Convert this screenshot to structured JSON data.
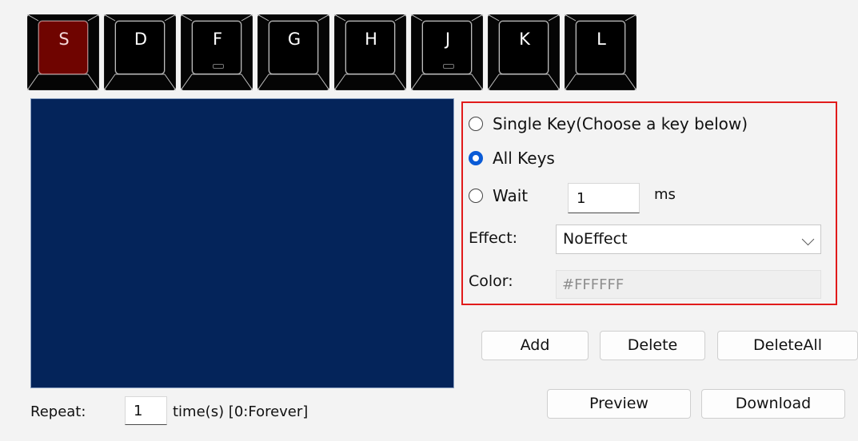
{
  "keys": [
    "S",
    "D",
    "F",
    "G",
    "H",
    "J",
    "K",
    "L"
  ],
  "active_key": "S",
  "home_keys": [
    "F",
    "J"
  ],
  "settings": {
    "single_key_label": "Single Key(Choose a key below)",
    "all_keys_label": "All Keys",
    "wait_label": "Wait",
    "wait_value": "1",
    "wait_unit": "ms",
    "selected_mode": "All Keys",
    "effect_label": "Effect:",
    "effect_value": "NoEffect",
    "color_label": "Color:",
    "color_value": "#FFFFFF"
  },
  "buttons": {
    "add": "Add",
    "delete": "Delete",
    "delete_all": "DeleteAll",
    "preview": "Preview",
    "download": "Download"
  },
  "repeat": {
    "label": "Repeat:",
    "value": "1",
    "hint": "time(s) [0:Forever]"
  },
  "colors": {
    "preview_bg": "#04245a",
    "active_key": "#6f0400",
    "highlight_border": "#e11b1b",
    "radio_accent": "#0a5bd6"
  },
  "icons": {
    "select_arrow": "chevron-down-icon"
  }
}
